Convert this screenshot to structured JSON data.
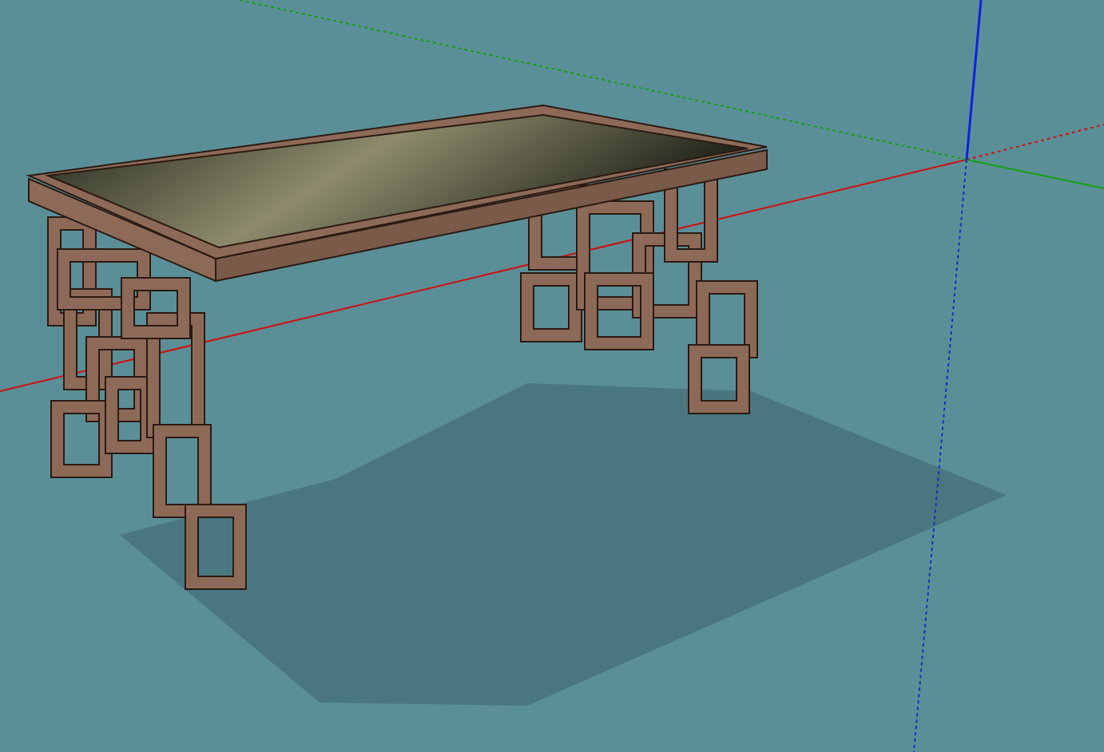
{
  "viewport": {
    "show_axes": true,
    "show_shadow": true
  }
}
